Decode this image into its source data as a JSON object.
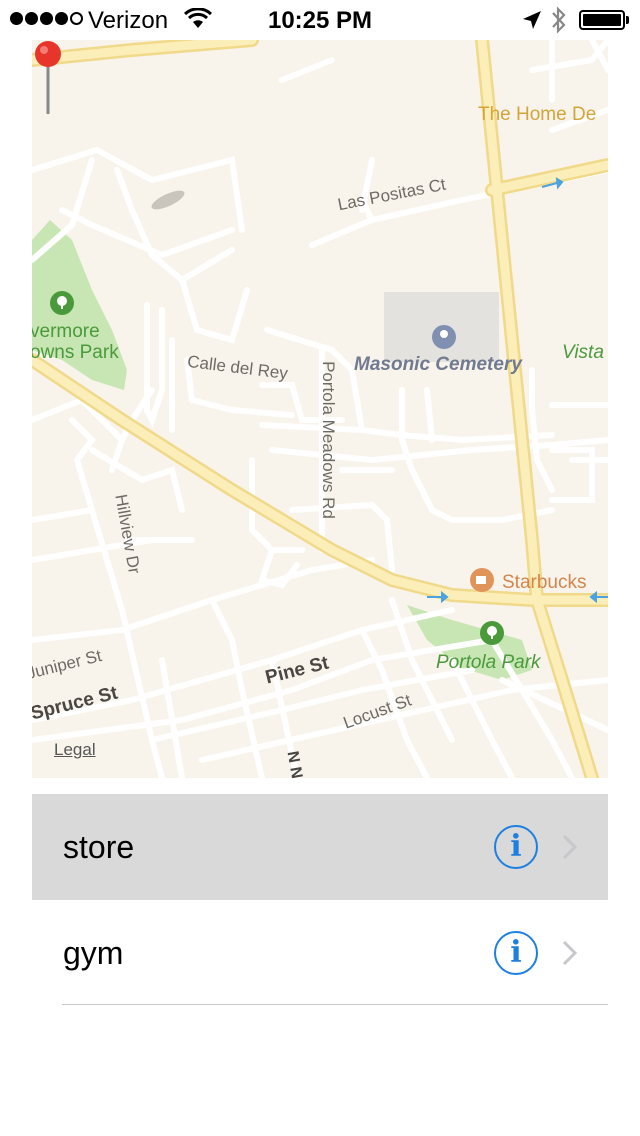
{
  "status_bar": {
    "carrier": "Verizon",
    "time": "10:25 PM",
    "signal_bars_filled": 4,
    "signal_bars_total": 5,
    "icons": [
      "wifi-icon",
      "location-arrow-icon",
      "bluetooth-icon",
      "battery-icon"
    ],
    "battery_level": 1.0
  },
  "map": {
    "labels": {
      "las_positas": "Las Positas Ct",
      "calle_del_rey": "Calle del Rey",
      "portola_meadows": "Portola Meadows Rd",
      "hillview": "Hillview Dr",
      "juniper": "Juniper St",
      "spruce": "Spruce St",
      "pine": "Pine St",
      "locust": "Locust St",
      "masonic": "Masonic Cemetery",
      "starbucks": "Starbucks",
      "portola_park": "Portola Park",
      "home_depot": "The Home De",
      "vista": "Vista",
      "livermore_line1": "vermore",
      "livermore_line2": "owns Park",
      "n_n": "N N"
    },
    "legal": "Legal",
    "colors": {
      "land": "#f8f4ec",
      "highway": "#fbe7a4",
      "park": "#c8e6b4",
      "road": "#ffffff"
    }
  },
  "list": {
    "items": [
      {
        "label": "store",
        "selected": true
      },
      {
        "label": "gym",
        "selected": false
      }
    ],
    "accent": "#1d7fe0"
  }
}
